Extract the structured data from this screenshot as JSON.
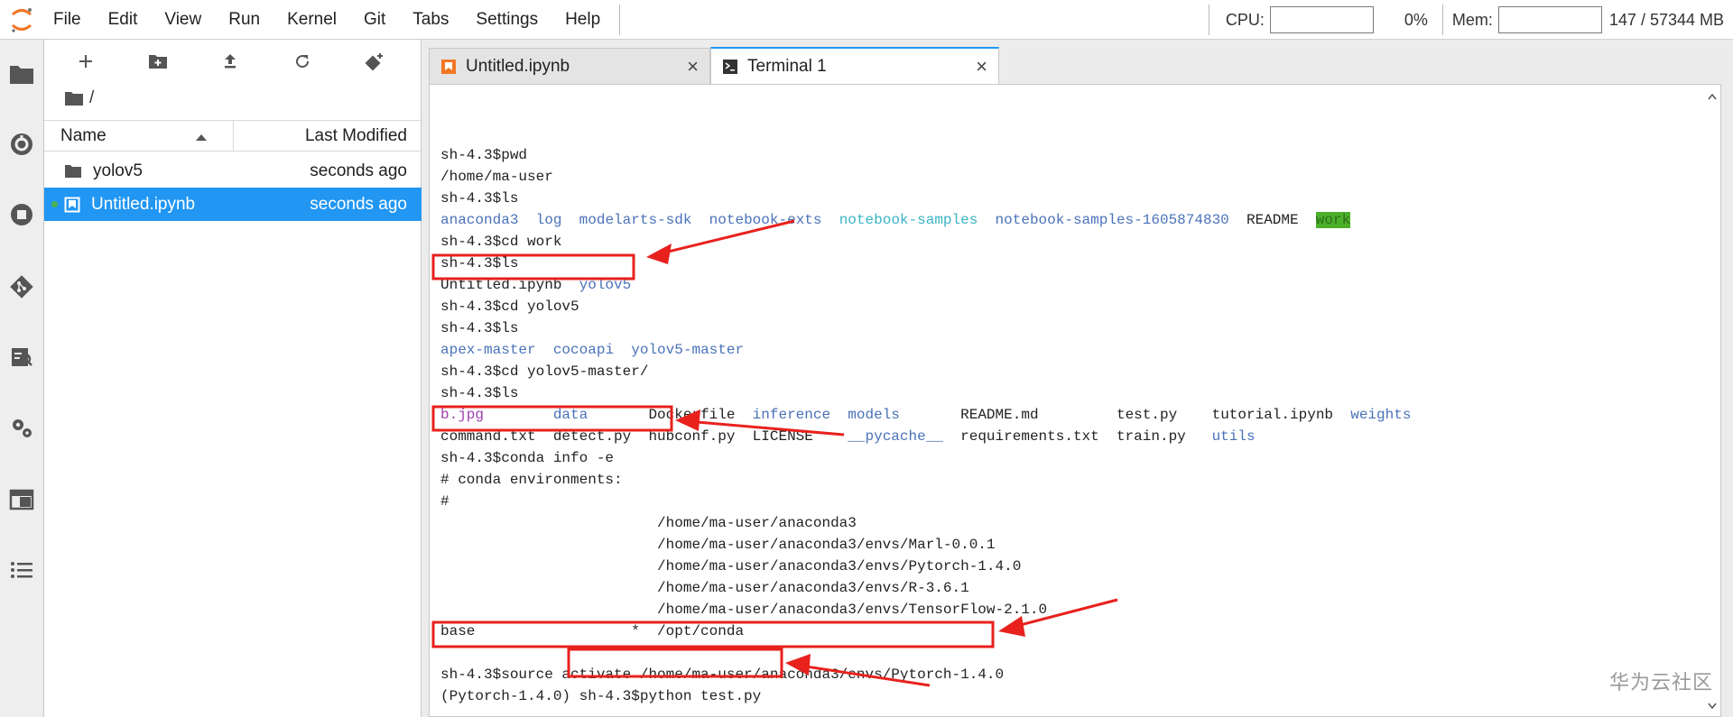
{
  "menubar": {
    "items": [
      "File",
      "Edit",
      "View",
      "Run",
      "Kernel",
      "Git",
      "Tabs",
      "Settings",
      "Help"
    ],
    "cpu_label": "CPU:",
    "cpu_value": "0%",
    "mem_label": "Mem:",
    "mem_value": "147 / 57344 MB"
  },
  "filebrowser": {
    "breadcrumb": "/",
    "col_name": "Name",
    "col_modified": "Last Modified",
    "files": [
      {
        "name": "yolov5",
        "modified": "seconds ago",
        "kind": "folder"
      },
      {
        "name": "Untitled.ipynb",
        "modified": "seconds ago",
        "kind": "notebook",
        "selected": true
      }
    ]
  },
  "tabs": [
    {
      "label": "Untitled.ipynb",
      "close": "×",
      "active": false
    },
    {
      "label": "Terminal 1",
      "close": "×",
      "active": true
    }
  ],
  "terminal": {
    "lines": [
      "sh-4.3$pwd",
      "/home/ma-user",
      "sh-4.3$ls",
      "anaconda3  log  modelarts-sdk  notebook-exts  notebook-samples  notebook-samples-1605874830  README  work",
      "sh-4.3$cd work",
      "sh-4.3$ls",
      "Untitled.ipynb  yolov5",
      "sh-4.3$cd yolov5",
      "sh-4.3$ls",
      "apex-master  cocoapi  yolov5-master",
      "sh-4.3$cd yolov5-master/",
      "sh-4.3$ls",
      "b.jpg        data       Dockerfile  inference  models       README.md         test.py    tutorial.ipynb  weights",
      "command.txt  detect.py  hubconf.py  LICENSE    __pycache__  requirements.txt  train.py   utils",
      "sh-4.3$conda info -e",
      "# conda environments:",
      "#",
      "                         /home/ma-user/anaconda3",
      "                         /home/ma-user/anaconda3/envs/Marl-0.0.1",
      "                         /home/ma-user/anaconda3/envs/Pytorch-1.4.0",
      "                         /home/ma-user/anaconda3/envs/R-3.6.1",
      "                         /home/ma-user/anaconda3/envs/TensorFlow-2.1.0",
      "base                  *  /opt/conda",
      "",
      "sh-4.3$source activate /home/ma-user/anaconda3/envs/Pytorch-1.4.0",
      "(Pytorch-1.4.0) sh-4.3$python test.py"
    ]
  },
  "watermark": "华为云社区",
  "colors": {
    "accent": "#2196f3",
    "annotation": "#e8211d",
    "ls_dir": "#4a72b8",
    "ls_link": "#38b5c4",
    "ls_image": "#a03fb0"
  }
}
